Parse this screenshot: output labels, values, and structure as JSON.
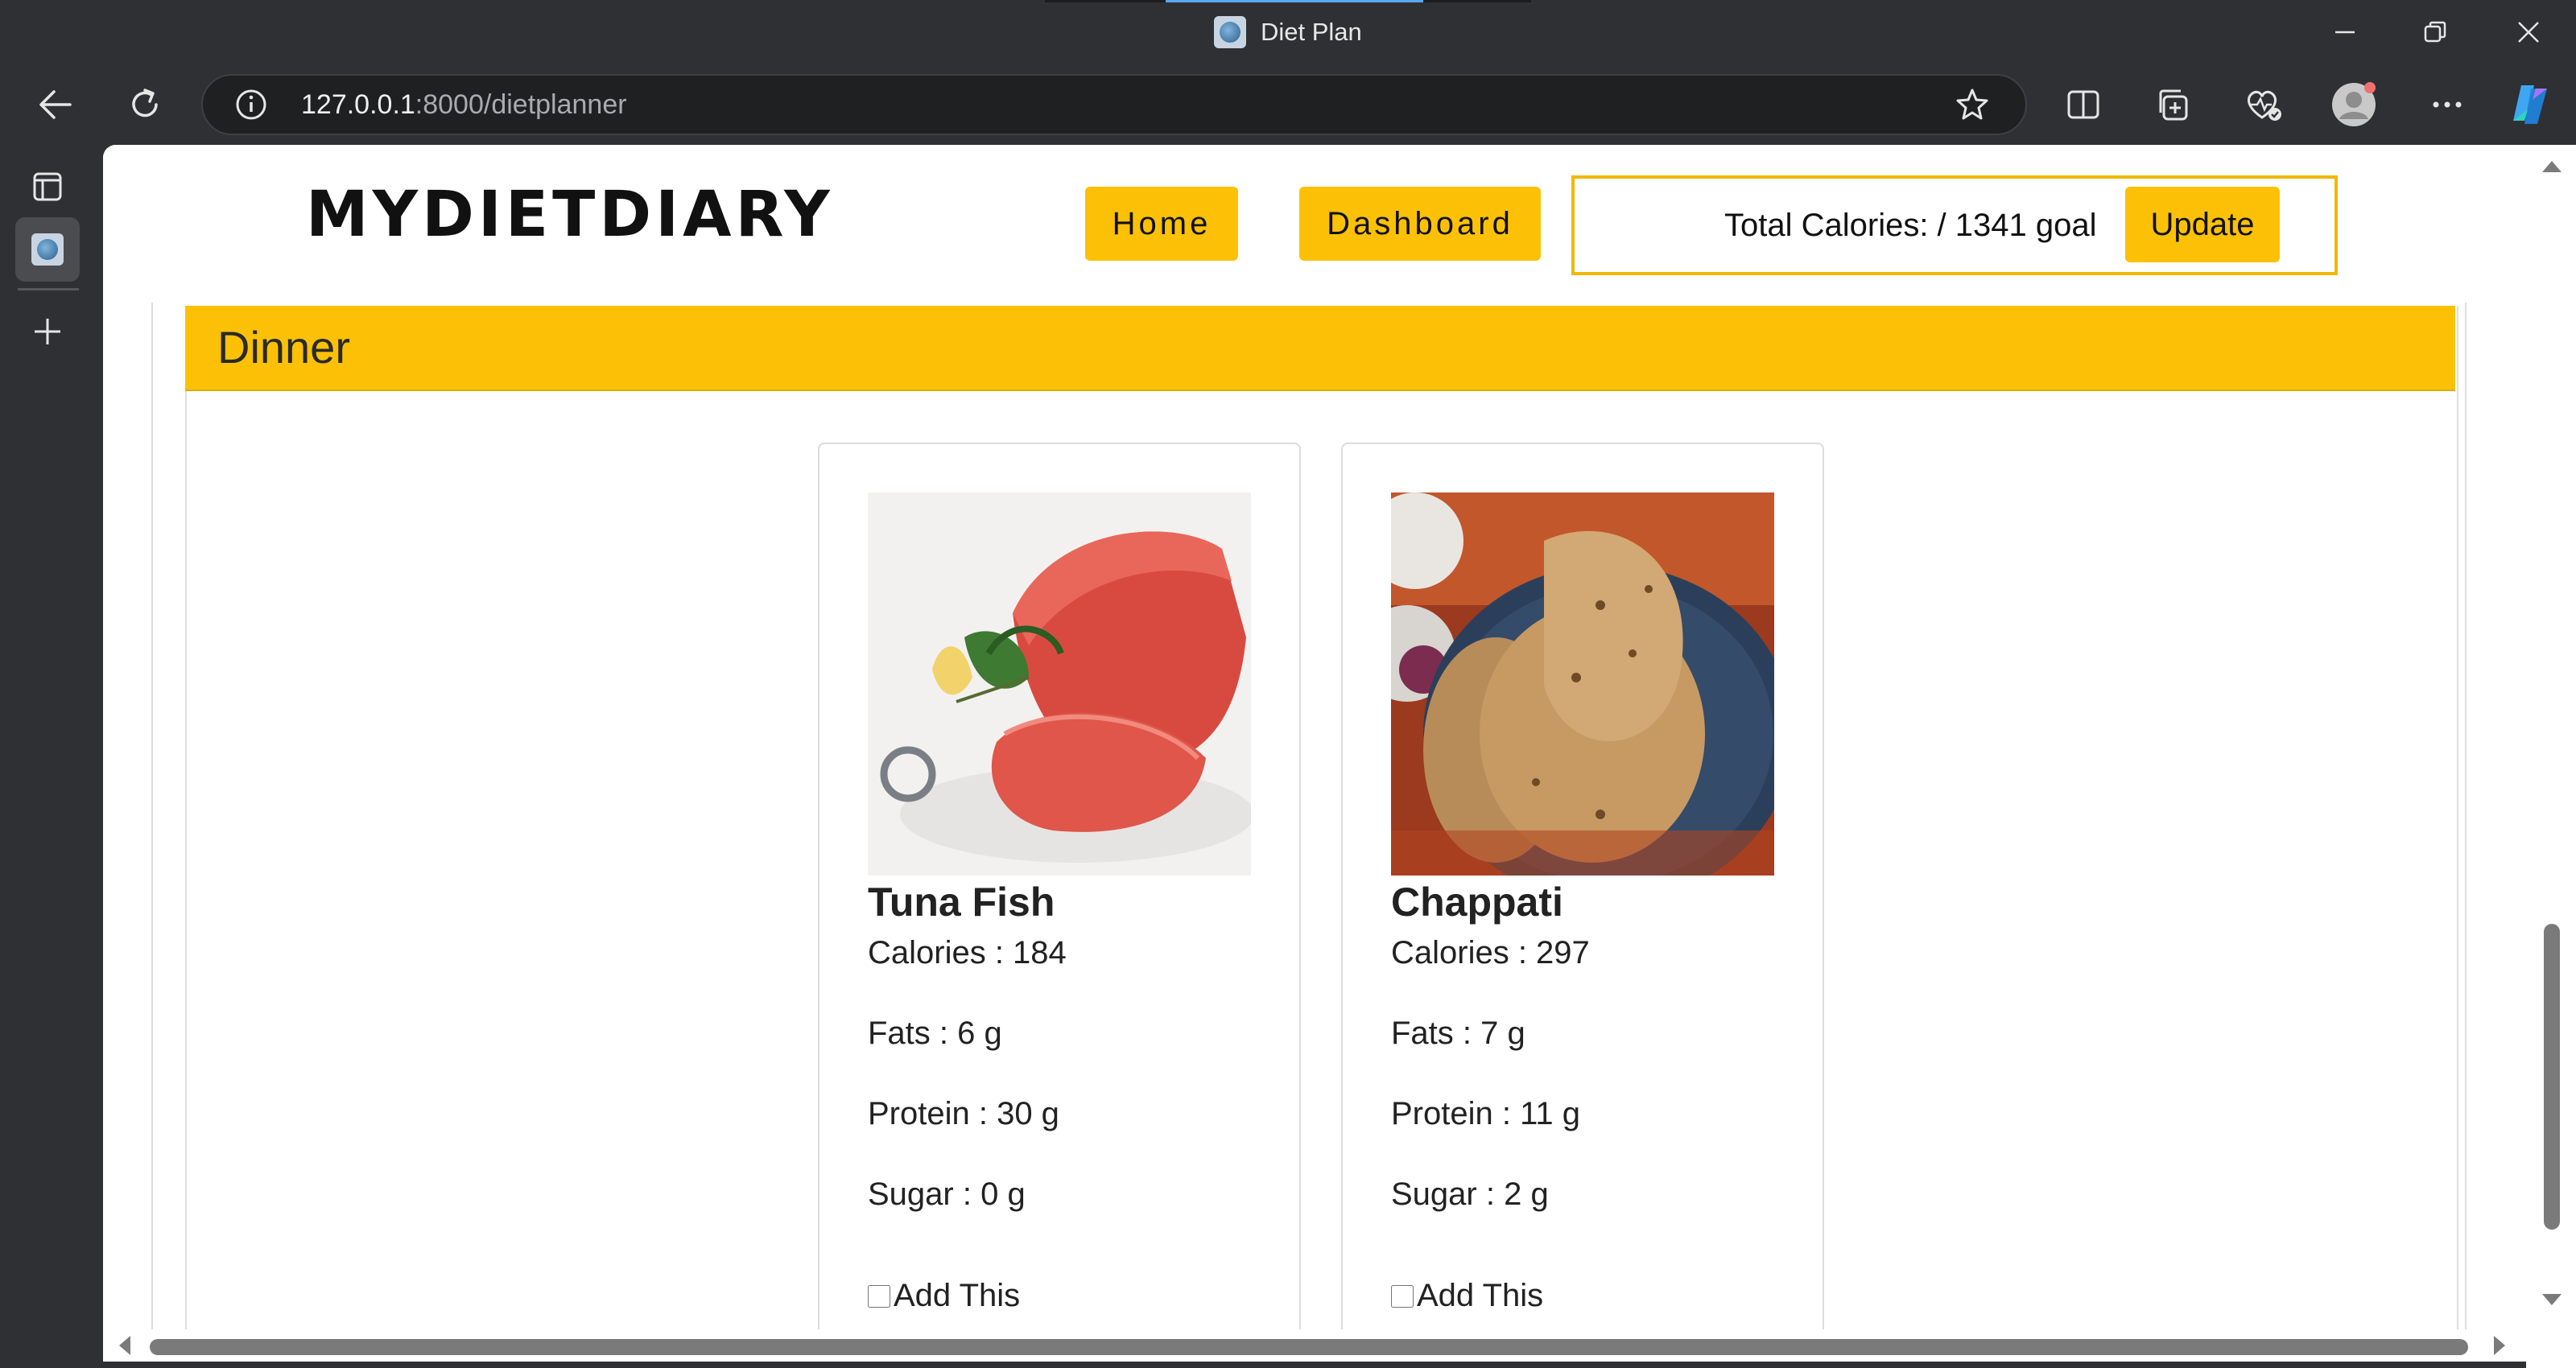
{
  "browser": {
    "tab_title": "Diet Plan",
    "url_host": "127.0.0.1",
    "url_path": ":8000/dietplanner"
  },
  "site": {
    "brand": "MYDIETDIARY",
    "nav": {
      "home": "Home",
      "dashboard": "Dashboard"
    },
    "calories_text": "Total Calories: / 1341 goal",
    "update_label": "Update"
  },
  "section": {
    "title": "Dinner"
  },
  "foods": [
    {
      "name": "Tuna Fish",
      "calories": "Calories : 184",
      "fats": "Fats : 6 g",
      "protein": "Protein : 30 g",
      "sugar": "Sugar : 0 g",
      "add_label": "Add This",
      "checked": false
    },
    {
      "name": "Chappati",
      "calories": "Calories : 297",
      "fats": "Fats : 7 g",
      "protein": "Protein : 11 g",
      "sugar": "Sugar : 2 g",
      "add_label": "Add This",
      "checked": false
    }
  ],
  "colors": {
    "accent": "#fcc107",
    "accent_border": "#f0b800",
    "chrome": "#2f3033"
  },
  "icons": [
    "back-icon",
    "refresh-icon",
    "info-icon",
    "star-icon",
    "split-screen-icon",
    "collections-icon",
    "browser-essentials-icon",
    "profile-icon",
    "more-icon",
    "copilot-icon",
    "minimize-icon",
    "restore-icon",
    "close-icon",
    "tab-actions-icon",
    "new-tab-icon"
  ]
}
